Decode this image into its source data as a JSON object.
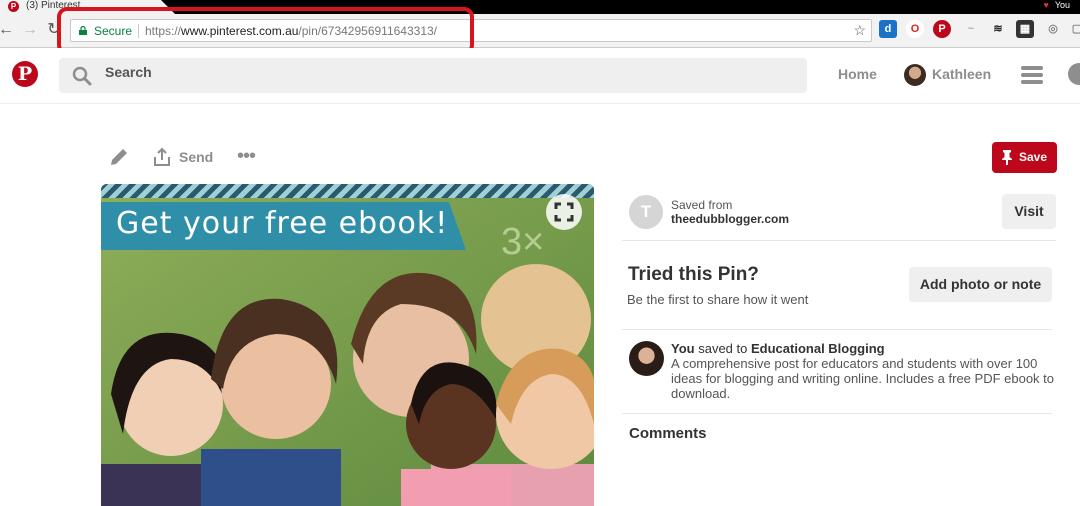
{
  "browser": {
    "tab_title": "(3) Pinterest",
    "user_label": "You",
    "secure_label": "Secure",
    "url_scheme": "https://",
    "url_host": "www.pinterest.com.au",
    "url_path": "/pin/67342956911643313/"
  },
  "header": {
    "logo": "P",
    "search_placeholder": "Search",
    "home_label": "Home",
    "user_name": "Kathleen"
  },
  "pin_actions": {
    "send_label": "Send",
    "more_label": "•••",
    "save_label": "Save"
  },
  "pin_image": {
    "banner_text": "Get your free ebook!"
  },
  "details": {
    "source_initial": "T",
    "saved_from_label": "Saved from",
    "source_domain": "theedubblogger.com",
    "visit_label": "Visit",
    "tried_title": "Tried this Pin?",
    "tried_subtitle": "Be the first to share how it went",
    "add_photo_label": "Add photo or note",
    "saver_name": "You",
    "saved_to_text": "saved to",
    "board_name": "Educational Blogging",
    "description": "A comprehensive post for educators and students with over 100 ideas for blogging and writing online. Includes a free PDF ebook to download.",
    "comments_label": "Comments"
  },
  "colors": {
    "brand_red": "#bd081c",
    "highlight_red": "#d6161c",
    "secure_green": "#0b8043",
    "banner_teal": "#2f8fa8"
  }
}
